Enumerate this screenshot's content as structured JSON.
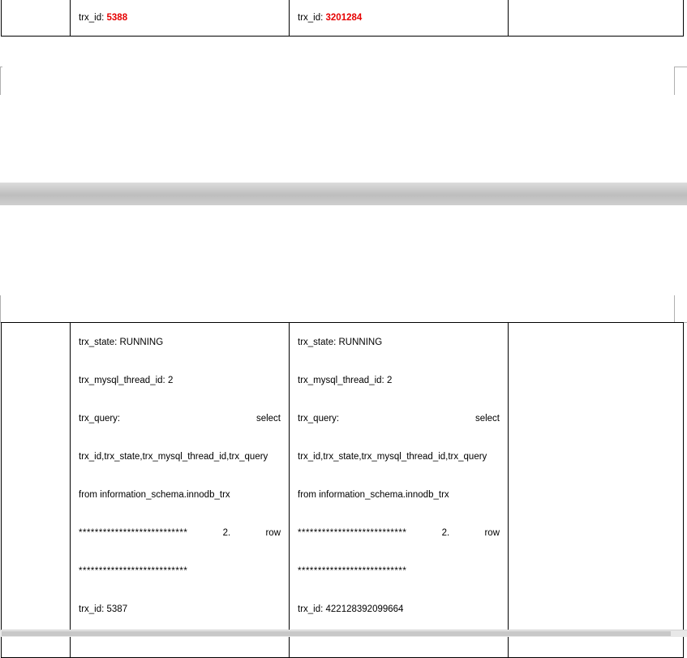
{
  "top_row": {
    "col2": {
      "label": "trx_id: ",
      "value": "5388"
    },
    "col3": {
      "label": "trx_id: ",
      "value": "3201284"
    }
  },
  "bottom_row": {
    "col2": {
      "trx_state": "trx_state: RUNNING",
      "thread_id": "trx_mysql_thread_id: 2",
      "query_label": "trx_query:",
      "query_word": "select",
      "query_line2": "trx_id,trx_state,trx_mysql_thread_id,trx_query",
      "query_line3": "from information_schema.innodb_trx",
      "row_stars": "***************************",
      "row_num": "2.",
      "row_word": "row",
      "stars_line": "***************************",
      "trx_id": "trx_id: 5387"
    },
    "col3": {
      "trx_state": "trx_state: RUNNING",
      "thread_id": "trx_mysql_thread_id: 2",
      "query_label": "trx_query:",
      "query_word": "select",
      "query_line2": "trx_id,trx_state,trx_mysql_thread_id,trx_query",
      "query_line3": "from information_schema.innodb_trx",
      "row_stars": "***************************",
      "row_num": "2.",
      "row_word": "row",
      "stars_line": "***************************",
      "trx_id": "trx_id: 422128392099664"
    }
  },
  "colors": {
    "highlight": "#e60000",
    "page_gap": "#c8c8c8"
  }
}
